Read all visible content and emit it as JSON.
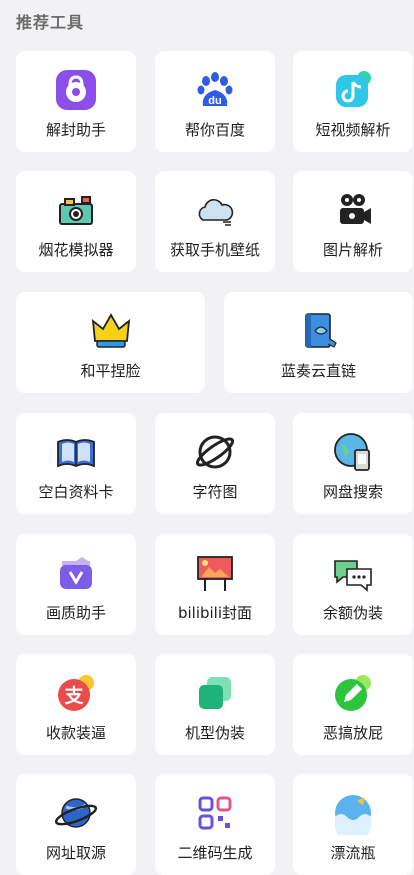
{
  "section": {
    "title": "推荐工具"
  },
  "tools": [
    {
      "label": "解封助手",
      "icon": "unlock-purple-icon"
    },
    {
      "label": "帮你百度",
      "icon": "baidu-paw-icon"
    },
    {
      "label": "短视频解析",
      "icon": "tiktok-icon"
    },
    {
      "label": "烟花模拟器",
      "icon": "camera-icon"
    },
    {
      "label": "获取手机壁纸",
      "icon": "cloud-icon"
    },
    {
      "label": "图片解析",
      "icon": "video-camera-icon"
    },
    {
      "label": "和平捏脸",
      "icon": "crown-icon"
    },
    {
      "label": "蓝奏云直链",
      "icon": "blue-book-icon"
    },
    {
      "label": "空白资料卡",
      "icon": "open-book-icon"
    },
    {
      "label": "字符图",
      "icon": "planet-outline-icon"
    },
    {
      "label": "网盘搜索",
      "icon": "globe-phone-icon"
    },
    {
      "label": "画质助手",
      "icon": "purple-v-icon"
    },
    {
      "label": "bilibili封面",
      "icon": "billboard-icon"
    },
    {
      "label": "余额伪装",
      "icon": "chat-bubbles-icon"
    },
    {
      "label": "收款装逼",
      "icon": "alipay-icon"
    },
    {
      "label": "机型伪装",
      "icon": "green-squares-icon"
    },
    {
      "label": "恶搞放屁",
      "icon": "green-pencil-icon"
    },
    {
      "label": "网址取源",
      "icon": "saturn-icon"
    },
    {
      "label": "二维码生成",
      "icon": "qr-code-icon"
    },
    {
      "label": "漂流瓶",
      "icon": "wave-icon"
    }
  ],
  "colors": {
    "background": "#f2f2f4",
    "card": "#ffffff",
    "purple": "#8b4ee8",
    "baidu_blue": "#2f5ce6",
    "cyan": "#2ec7e8"
  }
}
